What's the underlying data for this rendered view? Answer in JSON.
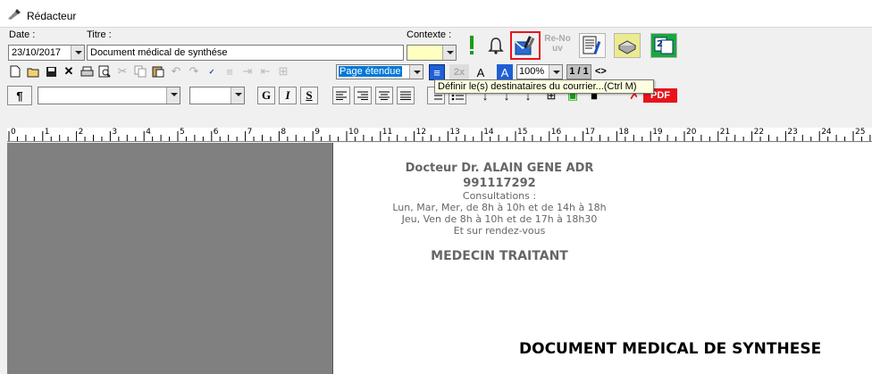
{
  "window": {
    "title": "Rédacteur"
  },
  "header": {
    "date_label": "Date :",
    "date_value": "23/10/2017",
    "title_label": "Titre :",
    "title_value": "Document médical de synthése",
    "context_label": "Contexte :",
    "context_value": ""
  },
  "toolbar": {
    "view_mode": "Page étendue",
    "zoom": "100%",
    "page_indicator": "1 / 1",
    "nav_symbol": "<>",
    "paragraph_symbol": "¶",
    "font_name": "",
    "font_size": "",
    "bold": "G",
    "italic": "I",
    "strike": "S",
    "renouv": "Re-Nouv",
    "pdf": "PDF",
    "scale_2x": "2x"
  },
  "tooltip": {
    "text": "Définir le(s) destinataires du courrier...(Ctrl M)"
  },
  "ruler": {
    "labels": [
      "0",
      "1",
      "2",
      "3",
      "4",
      "5",
      "6",
      "7",
      "8",
      "9",
      "10",
      "11",
      "12",
      "13",
      "14",
      "15",
      "16",
      "17",
      "18",
      "19",
      "20",
      "21",
      "22",
      "23",
      "24",
      "25"
    ]
  },
  "document": {
    "doctor": "Docteur Dr. ALAIN GENE ADR",
    "phone": "991117292",
    "consult_title": "Consultations :",
    "hours_1": "Lun, Mar, Mer, de 8h à 10h et de 14h à 18h",
    "hours_2": "Jeu, Ven de 8h à 10h et de 17h à 18h30",
    "rdv": "Et sur rendez-vous",
    "role": "MEDECIN TRAITANT",
    "heading": "DOCUMENT MEDICAL DE SYNTHESE"
  },
  "colors": {
    "highlight_red": "#e8141c",
    "context_yellow": "#ffffc0",
    "selection_blue": "#0078d7",
    "page_gray": "#808080",
    "tooltip_bg": "#ffffe1"
  }
}
